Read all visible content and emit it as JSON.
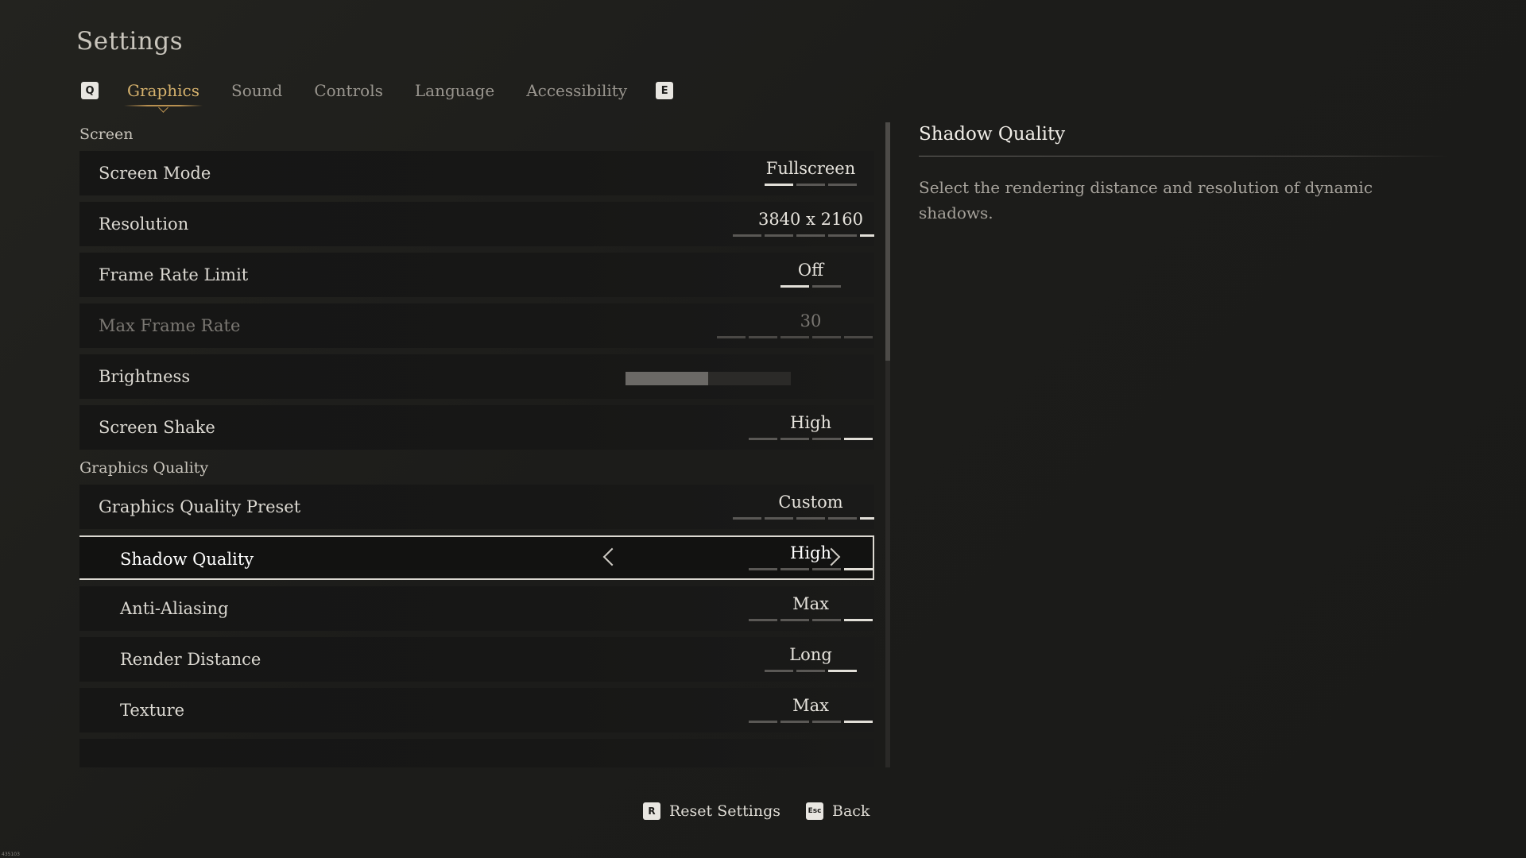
{
  "page": {
    "title": "Settings"
  },
  "tabs": {
    "prev_key": "Q",
    "next_key": "E",
    "items": [
      {
        "label": "Graphics",
        "active": true
      },
      {
        "label": "Sound",
        "active": false
      },
      {
        "label": "Controls",
        "active": false
      },
      {
        "label": "Language",
        "active": false
      },
      {
        "label": "Accessibility",
        "active": false
      }
    ]
  },
  "sections": {
    "screen": {
      "title": "Screen",
      "rows": {
        "screen_mode": {
          "label": "Screen Mode",
          "value": "Fullscreen",
          "option_count": 3,
          "selected_index": 0
        },
        "resolution": {
          "label": "Resolution",
          "value": "3840 x 2160",
          "option_count": 5,
          "selected_index": 4
        },
        "frame_rate_limit": {
          "label": "Frame Rate Limit",
          "value": "Off",
          "option_count": 2,
          "selected_index": 0
        },
        "max_frame_rate": {
          "label": "Max Frame Rate",
          "value": "30",
          "option_count": 6,
          "selected_index": 0,
          "disabled": true
        },
        "brightness": {
          "label": "Brightness",
          "value": "5",
          "level_fraction": 0.5
        },
        "screen_shake": {
          "label": "Screen Shake",
          "value": "High",
          "option_count": 4,
          "selected_index": 3
        }
      }
    },
    "graphics_quality": {
      "title": "Graphics Quality",
      "rows": {
        "preset": {
          "label": "Graphics Quality Preset",
          "value": "Custom",
          "option_count": 5,
          "selected_index": 4
        },
        "shadow_quality": {
          "label": "Shadow Quality",
          "value": "High",
          "option_count": 4,
          "selected_index": 3,
          "selected": true
        },
        "anti_aliasing": {
          "label": "Anti-Aliasing",
          "value": "Max",
          "option_count": 4,
          "selected_index": 3
        },
        "render_distance": {
          "label": "Render Distance",
          "value": "Long",
          "option_count": 3,
          "selected_index": 2
        },
        "texture": {
          "label": "Texture",
          "value": "Max",
          "option_count": 4,
          "selected_index": 3
        }
      }
    }
  },
  "detail": {
    "title": "Shadow Quality",
    "description": "Select the rendering distance and resolution of dynamic shadows."
  },
  "footer": {
    "reset": {
      "key": "R",
      "label": "Reset Settings"
    },
    "back": {
      "key": "Esc",
      "label": "Back"
    }
  },
  "corner_mark": "435103",
  "colors": {
    "accent": "#d6b26d",
    "background": "#1c1c1a",
    "pip_on": "#e2dfd8",
    "pip_off": "#5a5855"
  },
  "icons": {
    "prev_option": "chevron-left-icon",
    "next_option": "chevron-right-icon"
  }
}
